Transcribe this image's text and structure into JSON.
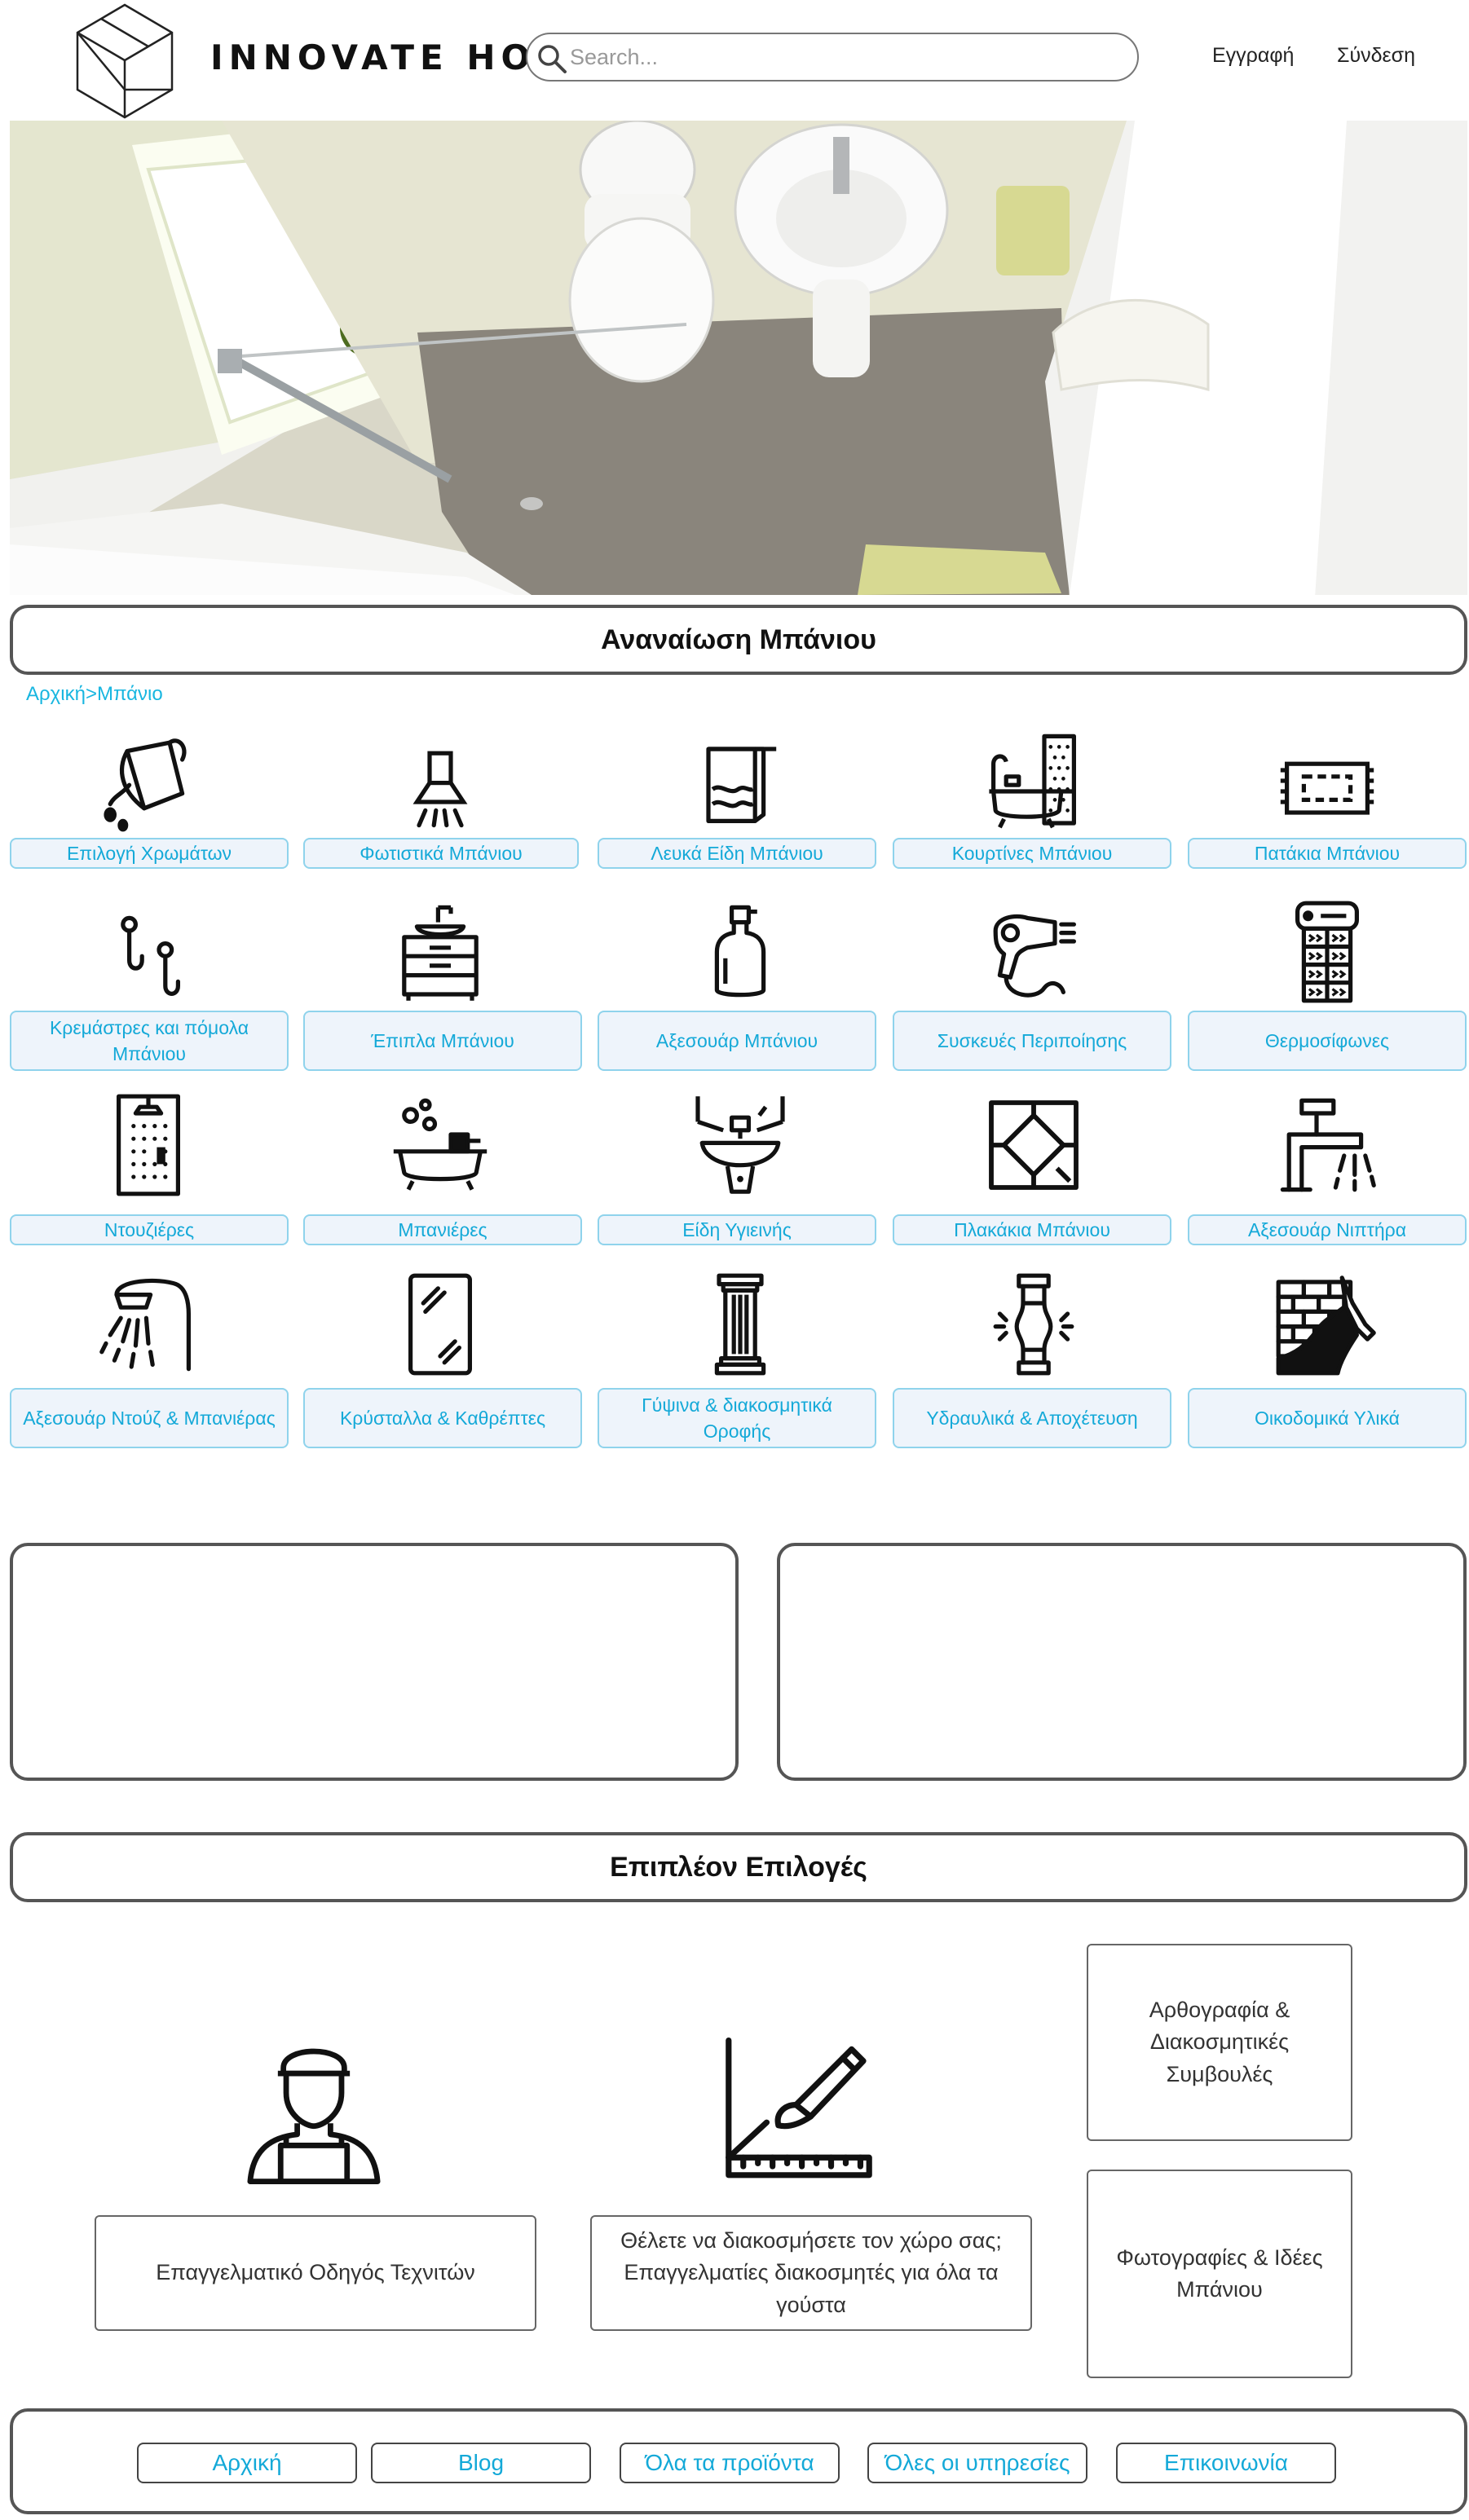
{
  "header": {
    "brand": "INNOVATE HOME",
    "search_placeholder": "Search...",
    "register_label": "Εγγραφή",
    "login_label": "Σύνδεση"
  },
  "main": {
    "title": "Αναναίωση Μπάνιου",
    "breadcrumb": {
      "home": "Αρχική",
      "separator": ">",
      "current": "Μπάνιο"
    },
    "categories": [
      {
        "label": "Επιλογή Χρωμάτων",
        "icon": "paint-bucket-icon"
      },
      {
        "label": "Φωτιστικά Μπάνιου",
        "icon": "ceiling-lamp-icon"
      },
      {
        "label": "Λευκά Είδη Μπάνιου",
        "icon": "towel-icon"
      },
      {
        "label": "Κουρτίνες Μπάνιου",
        "icon": "bathtub-curtain-icon"
      },
      {
        "label": "Πατάκια Μπάνιου",
        "icon": "bath-mat-icon"
      },
      {
        "label": "Κρεμάστρες και πόμολα Μπάνιου",
        "icon": "hooks-icon"
      },
      {
        "label": "Έπιπλα Μπάνιου",
        "icon": "vanity-cabinet-icon"
      },
      {
        "label": "Αξεσουάρ Μπάνιου",
        "icon": "soap-dispenser-icon"
      },
      {
        "label": "Συσκευές Περιποίησης",
        "icon": "hair-dryer-icon"
      },
      {
        "label": "Θερμοσίφωνες",
        "icon": "water-heater-icon"
      },
      {
        "label": "Ντουζιέρες",
        "icon": "shower-cabin-icon"
      },
      {
        "label": "Μπανιέρες",
        "icon": "bathtub-icon"
      },
      {
        "label": "Είδη Υγιεινής",
        "icon": "sink-icon"
      },
      {
        "label": "Πλακάκια Μπάνιου",
        "icon": "tiles-icon"
      },
      {
        "label": "Αξεσουάρ Νιπτήρα",
        "icon": "faucet-icon"
      },
      {
        "label": "Αξεσουάρ Ντούζ & Μπανιέρας",
        "icon": "shower-head-icon"
      },
      {
        "label": "Κρύσταλλα & Καθρέπτες",
        "icon": "mirror-icon"
      },
      {
        "label": "Γύψινα & διακοσμητικά Οροφής",
        "icon": "column-icon"
      },
      {
        "label": "Υδραυλικά & Αποχέτευση",
        "icon": "pipe-icon"
      },
      {
        "label": "Οικοδομικά Υλικά",
        "icon": "brick-wall-icon"
      }
    ]
  },
  "extras": {
    "title": "Επιπλέον Επιλογές",
    "craftsmen_label": "Επαγγελματικό Οδηγός Τεχνιτών",
    "decorators_label": "Θέλετε να διακοσμήσετε τον χώρο σας; Επαγγελματίες διακοσμητές για όλα τα γούστα",
    "articles_label": "Αρθογραφία & Διακοσμητικές Συμβουλές",
    "photos_label": "Φωτογραφίες & Ιδέες Μπάνιου"
  },
  "footer": {
    "nav": [
      "Αρχική",
      "Blog",
      "Όλα τα προϊόντα",
      "Όλες οι υπηρεσίες",
      "Επικοινωνία"
    ]
  }
}
